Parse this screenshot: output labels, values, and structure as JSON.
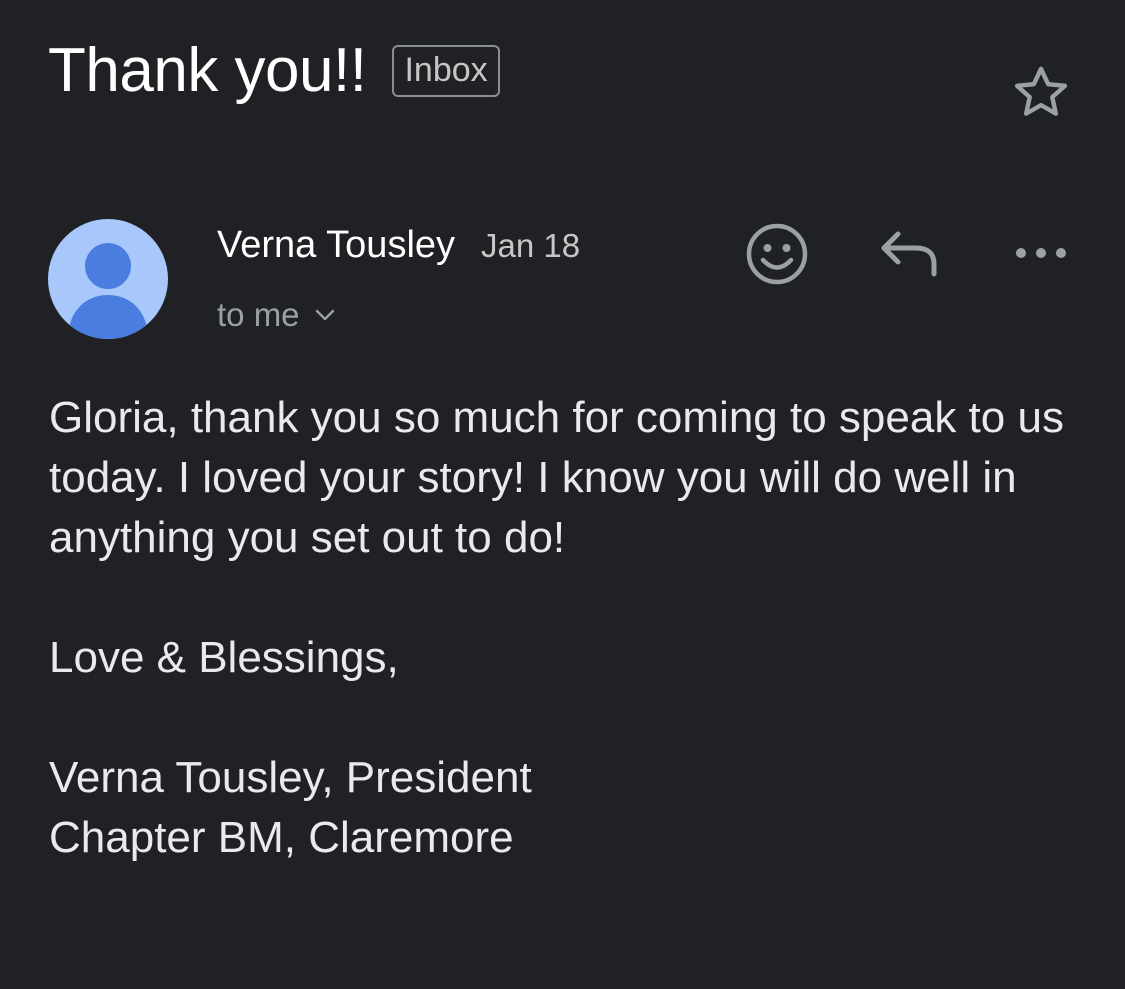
{
  "header": {
    "subject": "Thank you!!",
    "label": "Inbox",
    "star_icon": "star-outline-icon"
  },
  "message": {
    "sender_name": "Verna Tousley",
    "date": "Jan 18",
    "recipient": "to me",
    "avatar_icon": "person-avatar-icon",
    "actions": {
      "emoji_icon": "emoji-reaction-icon",
      "reply_icon": "reply-icon",
      "more_icon": "more-horizontal-icon"
    },
    "body": "Gloria, thank you so much for coming to speak to us today. I loved your story! I know you will do well in anything you set out to do!\n\nLove & Blessings,\n\nVerna Tousley, President\nChapter BM, Claremore"
  },
  "colors": {
    "background": "#202124",
    "text": "#e8eaed",
    "muted": "#9aa0a6",
    "avatar_bg": "#a8c7fa",
    "avatar_fg": "#4a7de0"
  }
}
